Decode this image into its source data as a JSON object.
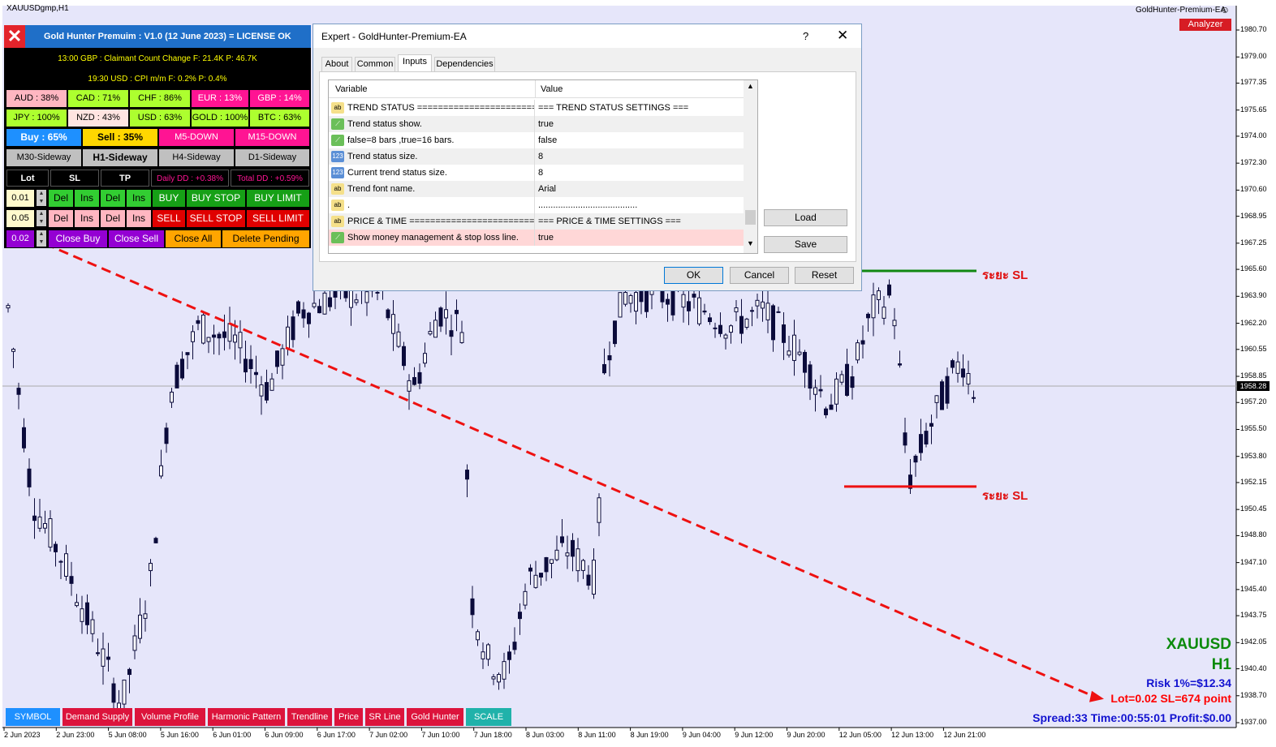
{
  "window": {
    "symbol_title": "XAUUSDgmp,H1",
    "ea_name": "GoldHunter-Premium-EA",
    "smiley": "☺",
    "analyzer_label": "Analyzer"
  },
  "chart_data": {
    "type": "candlestick",
    "symbol": "XAUUSD",
    "timeframe": "H1",
    "y_ticks": [
      "1980.70",
      "1979.00",
      "1977.35",
      "1975.65",
      "1974.00",
      "1972.30",
      "1970.60",
      "1968.95",
      "1967.25",
      "1965.60",
      "1963.90",
      "1962.20",
      "1960.55",
      "1958.85",
      "1957.20",
      "1955.50",
      "1953.80",
      "1952.15",
      "1950.45",
      "1948.80",
      "1947.10",
      "1945.40",
      "1943.75",
      "1942.05",
      "1940.40",
      "1938.70",
      "1937.00"
    ],
    "y_range": [
      1936.3,
      1981.3
    ],
    "current_price": "1958.28",
    "x_ticks": [
      "2 Jun 2023",
      "2 Jun 23:00",
      "5 Jun 08:00",
      "5 Jun 16:00",
      "6 Jun 01:00",
      "6 Jun 09:00",
      "6 Jun 17:00",
      "7 Jun 02:00",
      "7 Jun 10:00",
      "7 Jun 18:00",
      "8 Jun 03:00",
      "8 Jun 11:00",
      "8 Jun 19:00",
      "9 Jun 04:00",
      "9 Jun 12:00",
      "9 Jun 20:00",
      "12 Jun 05:00",
      "12 Jun 13:00",
      "12 Jun 21:00"
    ],
    "sl_levels": [
      {
        "price": 1965.5,
        "color": "#118811",
        "label": "ระยะ SL"
      },
      {
        "price": 1951.9,
        "color": "#ee1111",
        "label": "ระยะ SL"
      }
    ],
    "trend_arrow": {
      "from_price": 1967.6,
      "to_price": 1938.6,
      "color": "#ee1111",
      "style": "dashed"
    }
  },
  "overlay": {
    "pair": "XAUUSD",
    "timeframe": "H1",
    "risk": "Risk 1%=$12.34",
    "lot_sl": "Lot=0.02 SL=674 point",
    "spread": "Spread:33 Time:00:55:01 Profit:$0.00"
  },
  "panel": {
    "title": "Gold Hunter Premuim : V1.0 (12 June 2023) = LICENSE OK",
    "close_icon": "✕",
    "news1": "13:00 GBP : Claimant Count Change  F: 21.4K P: 46.7K",
    "news2": "19:30 USD : CPI m/m  F: 0.2% P: 0.4%",
    "strength_row1": [
      {
        "label": "AUD : 38%",
        "bg": "#ffb6c1",
        "fg": "#000"
      },
      {
        "label": "CAD : 71%",
        "bg": "#adff2f",
        "fg": "#000"
      },
      {
        "label": "CHF : 86%",
        "bg": "#adff2f",
        "fg": "#000"
      },
      {
        "label": "EUR : 13%",
        "bg": "#ff1493",
        "fg": "#fff"
      },
      {
        "label": "GBP : 14%",
        "bg": "#ff1493",
        "fg": "#fff"
      }
    ],
    "strength_row2": [
      {
        "label": "JPY : 100%",
        "bg": "#adff2f",
        "fg": "#000"
      },
      {
        "label": "NZD : 43%",
        "bg": "#ffe4e1",
        "fg": "#000"
      },
      {
        "label": "USD : 63%",
        "bg": "#adff2f",
        "fg": "#000"
      },
      {
        "label": "GOLD : 100%",
        "bg": "#adff2f",
        "fg": "#000"
      },
      {
        "label": "BTC : 63%",
        "bg": "#adff2f",
        "fg": "#000"
      }
    ],
    "buy_pct": "Buy : 65%",
    "sell_pct": "Sell : 35%",
    "m5": "M5-DOWN",
    "m15": "M15-DOWN",
    "trend_row": [
      "M30-Sideway",
      "H1-Sideway",
      "H4-Sideway",
      "D1-Sideway"
    ],
    "lot_header": "Lot",
    "sl_header": "SL",
    "tp_header": "TP",
    "daily_dd": "Daily DD : +0.38%",
    "total_dd": "Total DD : +0.59%",
    "lot1": "0.01",
    "lot2": "0.05",
    "lot3": "0.02",
    "del": "Del",
    "ins": "Ins",
    "buy": "BUY",
    "buy_stop": "BUY STOP",
    "buy_limit": "BUY LIMIT",
    "sell": "SELL",
    "sell_stop": "SELL STOP",
    "sell_limit": "SELL LIMIT",
    "close_buy": "Close Buy",
    "close_sell": "Close Sell",
    "close_all": "Close All",
    "delete_pending": "Delete Pending"
  },
  "dialog": {
    "title": "Expert - GoldHunter-Premium-EA",
    "help": "?",
    "close": "✕",
    "tabs": [
      "About",
      "Common",
      "Inputs",
      "Dependencies"
    ],
    "col_variable": "Variable",
    "col_value": "Value",
    "rows": [
      {
        "icon": "ab",
        "variable": "TREND STATUS ========================",
        "value": "=== TREND STATUS SETTINGS ==="
      },
      {
        "icon": "bool",
        "variable": "Trend status show.",
        "value": "true"
      },
      {
        "icon": "bool",
        "variable": "false=8 bars ,true=16 bars.",
        "value": "false"
      },
      {
        "icon": "123",
        "variable": "Trend status size.",
        "value": "8"
      },
      {
        "icon": "123",
        "variable": "Current trend status size.",
        "value": "8"
      },
      {
        "icon": "ab",
        "variable": "Trend font name.",
        "value": "Arial"
      },
      {
        "icon": "ab",
        "variable": ".",
        "value": "........................................"
      },
      {
        "icon": "ab",
        "variable": "PRICE & TIME ========================",
        "value": "=== PRICE & TIME SETTINGS ==="
      },
      {
        "icon": "bool",
        "variable": "Show money management & stop loss line.",
        "value": "true"
      }
    ],
    "load": "Load",
    "save": "Save",
    "ok": "OK",
    "cancel": "Cancel",
    "reset": "Reset"
  },
  "bottom_buttons": [
    {
      "label": "SYMBOL",
      "bg": "#1e90ff"
    },
    {
      "label": "Demand Supply",
      "bg": "#dc143c"
    },
    {
      "label": "Volume Profile",
      "bg": "#dc143c"
    },
    {
      "label": "Harmonic Pattern",
      "bg": "#dc143c"
    },
    {
      "label": "Trendline",
      "bg": "#dc143c"
    },
    {
      "label": "Price",
      "bg": "#dc143c"
    },
    {
      "label": "SR Line",
      "bg": "#dc143c"
    },
    {
      "label": "Gold Hunter",
      "bg": "#dc143c"
    },
    {
      "label": "SCALE",
      "bg": "#20b2aa"
    }
  ]
}
